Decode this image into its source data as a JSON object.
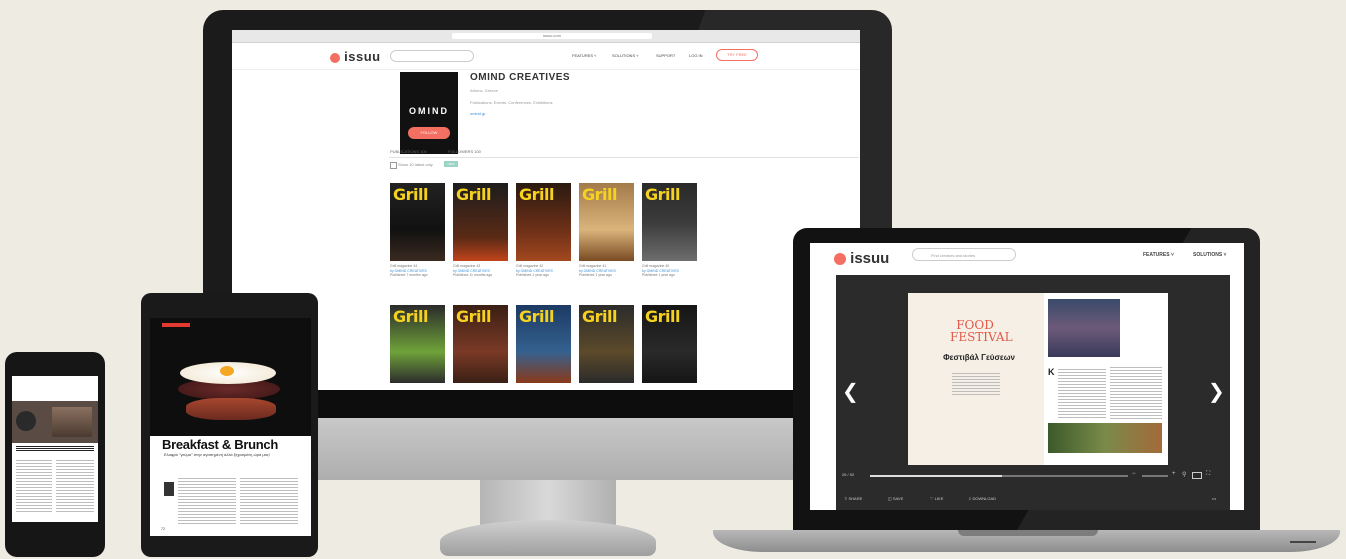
{
  "colors": {
    "background": "#eeece2",
    "brand": "#f26f61",
    "grill_yellow": "#f5d21f"
  },
  "monitor": {
    "address_bar": "issuu.com",
    "brand": "issuu",
    "nav": {
      "features": "FEATURES ˅",
      "solutions": "SOLUTIONS ˅",
      "support": "SUPPORT",
      "login": "LOG IN",
      "signup": "TRY FREE"
    },
    "avatar_text": "OMIND",
    "publisher": {
      "name": "OMIND CREATIVES",
      "location": "Athens, Greece",
      "description": "Publications, Events, Conferences, Exhibitions",
      "link": "omind.gr"
    },
    "follow_label": "FOLLOW",
    "tabs": {
      "publications": "PUBLICATIONS 100",
      "followers": "FOLLOWERS 100"
    },
    "filter_label": "Show 10 latest only",
    "new_badge": "NEW",
    "covers_row1": [
      {
        "title": "Grill",
        "caption": "Grill magazine 44",
        "publisher": "by OMIND CREATIVES",
        "date": "Published 7 months ago"
      },
      {
        "title": "Grill",
        "caption": "Grill magazine 43",
        "publisher": "by OMIND CREATIVES",
        "date": "Published 11 months ago"
      },
      {
        "title": "Grill",
        "caption": "Grill magazine 42",
        "publisher": "by OMIND CREATIVES",
        "date": "Published 1 year ago"
      },
      {
        "title": "Grill",
        "caption": "Grill magazine 41",
        "publisher": "by OMIND CREATIVES",
        "date": "Published 1 year ago"
      },
      {
        "title": "Grill",
        "caption": "Grill magazine 40",
        "publisher": "by OMIND CREATIVES",
        "date": "Published 1 year ago"
      }
    ],
    "covers_row2": [
      {
        "title": "Grill"
      },
      {
        "title": "Grill"
      },
      {
        "title": "Grill"
      },
      {
        "title": "Grill"
      },
      {
        "title": "Grill"
      }
    ]
  },
  "laptop": {
    "brand": "issuu",
    "search_placeholder": "Find creators and stories",
    "nav": {
      "features": "FEATURES ˅",
      "solutions": "SOLUTIONS ˅"
    },
    "spread": {
      "left_title": "FOOD FESTIVAL",
      "left_subtitle": "Φεστιβάλ Γεύσεων",
      "right_dropcap": "Κ"
    },
    "player": {
      "time": "26 / 52"
    },
    "actions": {
      "share": "SHARE",
      "save": "SAVE",
      "like": "LIKE",
      "download": "DOWNLOAD",
      "more": "•••"
    }
  },
  "tablet": {
    "headline": "Breakfast & Brunch",
    "subhead": "Ελαφρύ \"γεύμα\" στην αγαπημένη αλλά ξεχασμένη ώρα μας!",
    "page_number": "72"
  }
}
